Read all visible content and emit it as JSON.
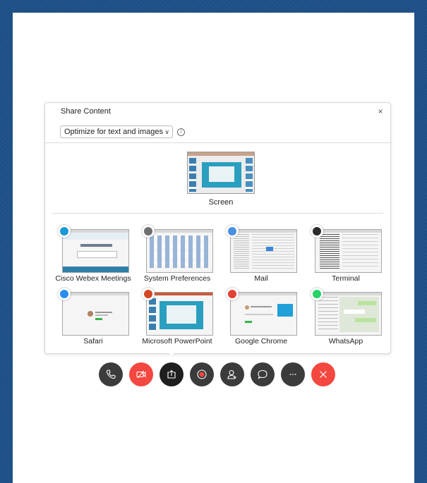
{
  "dialog": {
    "title": "Share Content",
    "close_label": "×",
    "optimize": {
      "value": "Optimize for text and images"
    },
    "info_label": "i"
  },
  "screen": {
    "label": "Screen"
  },
  "apps": [
    {
      "label": "Cisco Webex Meetings",
      "icon": "webex-icon",
      "color": "#1c9ad6"
    },
    {
      "label": "System Preferences",
      "icon": "gear-icon",
      "color": "#6f6f6f"
    },
    {
      "label": "Mail",
      "icon": "mail-icon",
      "color": "#4a90e2"
    },
    {
      "label": "Terminal",
      "icon": "terminal-icon",
      "color": "#2b2b2b"
    },
    {
      "label": "Safari",
      "icon": "compass-icon",
      "color": "#2a8ef0"
    },
    {
      "label": "Microsoft PowerPoint",
      "icon": "powerpoint-icon",
      "color": "#d24726"
    },
    {
      "label": "Google Chrome",
      "icon": "chrome-icon",
      "color": "#e34133"
    },
    {
      "label": "WhatsApp",
      "icon": "whatsapp-icon",
      "color": "#25d366"
    }
  ],
  "toolbar": {
    "buttons": [
      {
        "name": "phone-button",
        "icon": "phone-icon"
      },
      {
        "name": "video-button",
        "icon": "video-off-icon"
      },
      {
        "name": "share-button",
        "icon": "share-icon"
      },
      {
        "name": "record-button",
        "icon": "record-icon"
      },
      {
        "name": "participants-button",
        "icon": "participant-icon"
      },
      {
        "name": "chat-button",
        "icon": "chat-icon"
      },
      {
        "name": "more-button",
        "icon": "more-icon"
      },
      {
        "name": "leave-button",
        "icon": "close-icon"
      }
    ]
  },
  "colors": {
    "accent_red": "#f4473f",
    "dark_button": "#3b3b3b",
    "background": "#1d4f86"
  }
}
